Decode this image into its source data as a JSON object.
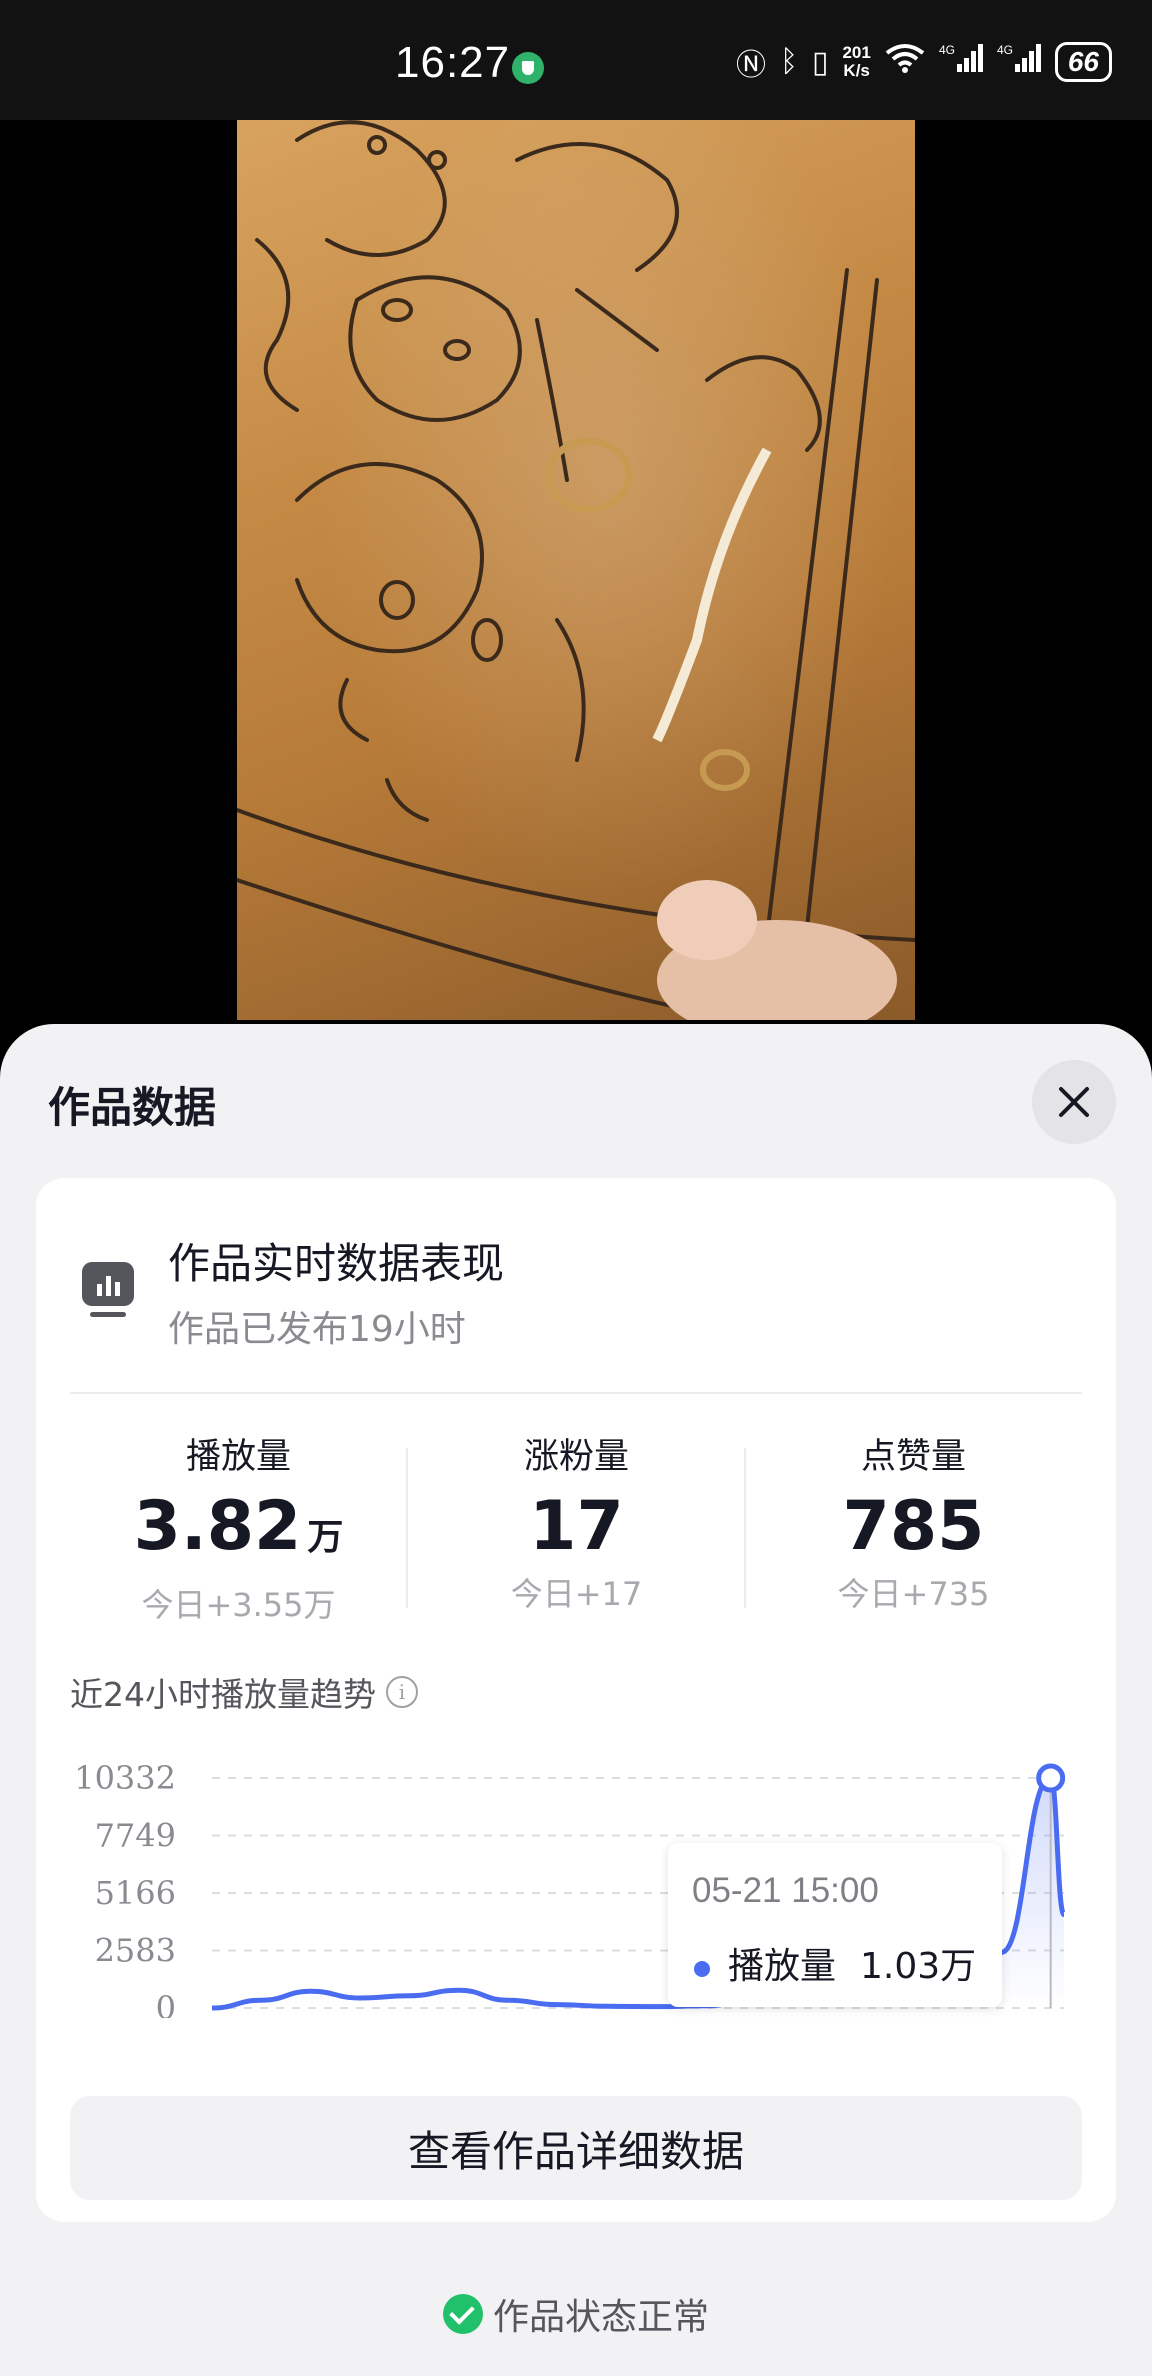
{
  "status_bar": {
    "time": "16:27",
    "net_speed_value": "201",
    "net_speed_unit": "K/s",
    "signal_1_label": "4G",
    "signal_2_label": "4G",
    "battery": "66"
  },
  "sheet": {
    "title": "作品数据",
    "close_icon": "close-icon"
  },
  "card": {
    "header_title": "作品实时数据表现",
    "header_sub": "作品已发布19小时",
    "stats": [
      {
        "label": "播放量",
        "value": "3.82",
        "unit": "万",
        "today": "今日+3.55万"
      },
      {
        "label": "涨粉量",
        "value": "17",
        "unit": "",
        "today": "今日+17"
      },
      {
        "label": "点赞量",
        "value": "785",
        "unit": "",
        "today": "今日+735"
      }
    ],
    "trend_title": "近24小时播放量趋势",
    "tooltip": {
      "time": "05-21 15:00",
      "series": "播放量",
      "value": "1.03万"
    },
    "detail_button": "查看作品详细数据"
  },
  "footer": {
    "status": "作品状态正常"
  },
  "colors": {
    "accent": "#4a6cf0",
    "ok": "#21c16b"
  },
  "chart_data": {
    "type": "line",
    "y_ticks": [
      "10332",
      "7749",
      "5166",
      "2583",
      "0"
    ],
    "ylim": [
      0,
      10332
    ],
    "grid": true,
    "series": [
      {
        "name": "播放量",
        "values": [
          0,
          350,
          750,
          450,
          550,
          800,
          350,
          150,
          80,
          60,
          100,
          350,
          500,
          600,
          700,
          1000,
          2500,
          10332,
          4200
        ]
      }
    ],
    "highlight_index": 17
  }
}
